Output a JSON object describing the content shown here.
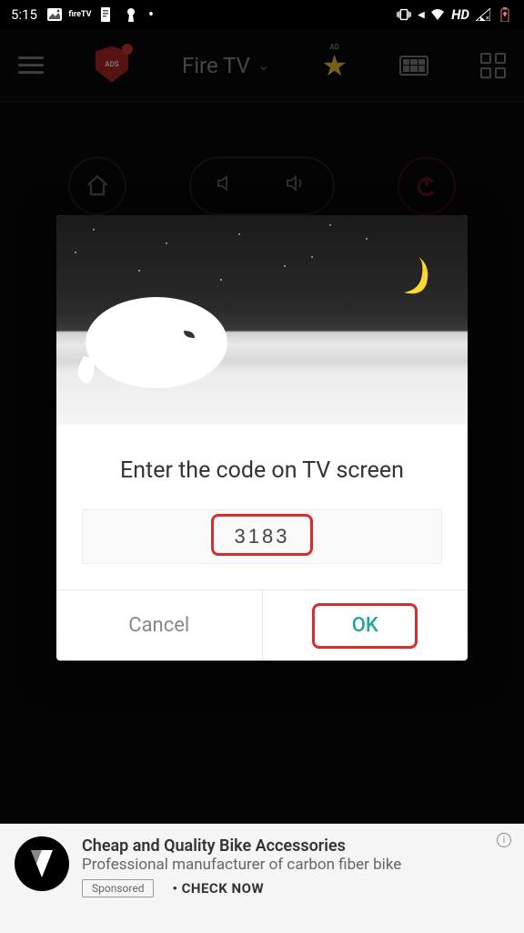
{
  "status_bar": {
    "time": "5:15",
    "hd_label": "HD"
  },
  "header": {
    "device_label": "Fire TV",
    "ads_label": "ADS",
    "ad_tag": "AD"
  },
  "dialog": {
    "title": "Enter the code on TV screen",
    "code_value": "3183",
    "cancel_label": "Cancel",
    "ok_label": "OK"
  },
  "ad": {
    "title": "Cheap and Quality Bike Accessories",
    "description": "Professional manufacturer of carbon fiber bike",
    "sponsored_label": "Sponsored",
    "cta": "CHECK NOW",
    "info_symbol": "i"
  }
}
